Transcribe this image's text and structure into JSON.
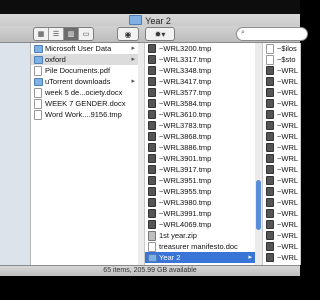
{
  "window": {
    "title": "Year 2",
    "status": "65 items, 205.99 GB available"
  },
  "toolbar": {
    "view_buttons": [
      "icon-view",
      "list-view",
      "column-view",
      "cover-flow-view"
    ],
    "active_view": "column-view",
    "quicklook_icon": "eye-icon",
    "action_icon": "gear-icon",
    "search_placeholder": ""
  },
  "column1": [
    {
      "label": "Microsoft User Data",
      "kind": "folder",
      "chevron": true
    },
    {
      "label": "oxford",
      "kind": "folder",
      "chevron": true,
      "selected": true
    },
    {
      "label": "Pile Documents.pdf",
      "kind": "doc"
    },
    {
      "label": "uTorrent downloads",
      "kind": "folder",
      "chevron": true
    },
    {
      "label": "week 5 de...ociety.docx",
      "kind": "doc"
    },
    {
      "label": "WEEK 7 GENDER.docx",
      "kind": "doc"
    },
    {
      "label": "Word Work....9156.tmp",
      "kind": "doc"
    }
  ],
  "column2": [
    {
      "label": "~WRL3200.tmp",
      "kind": "tmp"
    },
    {
      "label": "~WRL3317.tmp",
      "kind": "tmp"
    },
    {
      "label": "~WRL3348.tmp",
      "kind": "tmp"
    },
    {
      "label": "~WRL3417.tmp",
      "kind": "tmp"
    },
    {
      "label": "~WRL3577.tmp",
      "kind": "tmp"
    },
    {
      "label": "~WRL3584.tmp",
      "kind": "tmp"
    },
    {
      "label": "~WRL3610.tmp",
      "kind": "tmp"
    },
    {
      "label": "~WRL3783.tmp",
      "kind": "tmp"
    },
    {
      "label": "~WRL3868.tmp",
      "kind": "tmp"
    },
    {
      "label": "~WRL3886.tmp",
      "kind": "tmp"
    },
    {
      "label": "~WRL3901.tmp",
      "kind": "tmp"
    },
    {
      "label": "~WRL3917.tmp",
      "kind": "tmp"
    },
    {
      "label": "~WRL3951.tmp",
      "kind": "tmp"
    },
    {
      "label": "~WRL3955.tmp",
      "kind": "tmp"
    },
    {
      "label": "~WRL3980.tmp",
      "kind": "tmp"
    },
    {
      "label": "~WRL3991.tmp",
      "kind": "tmp"
    },
    {
      "label": "~WRL4069.tmp",
      "kind": "tmp"
    },
    {
      "label": "1st year.zip",
      "kind": "zip"
    },
    {
      "label": "treasurer manifesto.doc",
      "kind": "doc"
    },
    {
      "label": "Year 2",
      "kind": "folder",
      "chevron": true,
      "selected": true
    }
  ],
  "column3": [
    {
      "label": "~$ilos",
      "kind": "doc"
    },
    {
      "label": "~$sto",
      "kind": "doc"
    },
    {
      "label": "~WRL",
      "kind": "tmp"
    },
    {
      "label": "~WRL",
      "kind": "tmp"
    },
    {
      "label": "~WRL",
      "kind": "tmp"
    },
    {
      "label": "~WRL",
      "kind": "tmp"
    },
    {
      "label": "~WRL",
      "kind": "tmp"
    },
    {
      "label": "~WRL",
      "kind": "tmp"
    },
    {
      "label": "~WRL",
      "kind": "tmp"
    },
    {
      "label": "~WRL",
      "kind": "tmp"
    },
    {
      "label": "~WRL",
      "kind": "tmp"
    },
    {
      "label": "~WRL",
      "kind": "tmp"
    },
    {
      "label": "~WRL",
      "kind": "tmp"
    },
    {
      "label": "~WRL",
      "kind": "tmp"
    },
    {
      "label": "~WRL",
      "kind": "tmp"
    },
    {
      "label": "~WRL",
      "kind": "tmp"
    },
    {
      "label": "~WRL",
      "kind": "tmp"
    },
    {
      "label": "~WRL",
      "kind": "tmp"
    },
    {
      "label": "~WRL",
      "kind": "tmp"
    },
    {
      "label": "~WRL",
      "kind": "tmp"
    }
  ]
}
